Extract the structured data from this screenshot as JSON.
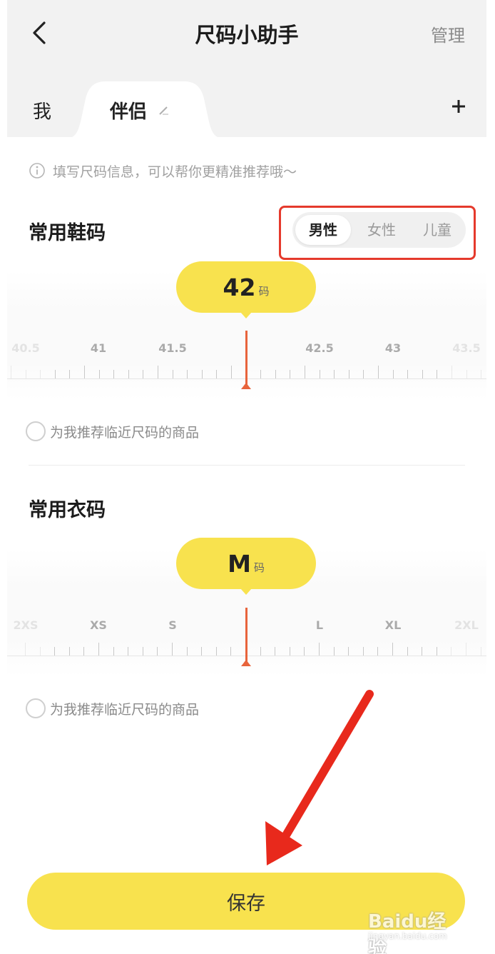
{
  "header": {
    "title": "尺码小助手",
    "manage_label": "管理"
  },
  "tabs": [
    {
      "label": "我"
    },
    {
      "label": "伴侣"
    }
  ],
  "icons": {
    "back": "chevron-left-icon",
    "edit": "pencil-icon",
    "add": "plus-icon",
    "info": "info-icon"
  },
  "tip": {
    "text": "填写尺码信息，可以帮你更精准推荐哦～"
  },
  "shoes": {
    "title": "常用鞋码",
    "gender_options": [
      "男性",
      "女性",
      "儿童"
    ],
    "selected_gender": "男性",
    "value": "42",
    "unit": "码",
    "ruler_labels": [
      "40.5",
      "41",
      "41.5",
      "42.5",
      "43",
      "43.5"
    ],
    "recommend_text": "为我推荐临近尺码的商品"
  },
  "clothes": {
    "title": "常用衣码",
    "value": "M",
    "unit": "码",
    "ruler_labels": [
      "2XS",
      "XS",
      "S",
      "L",
      "XL",
      "2XL"
    ],
    "recommend_text": "为我推荐临近尺码的商品"
  },
  "save_label": "保存",
  "watermark": {
    "brand": "Baidu经验",
    "url": "jingyan.baidu.com"
  },
  "colors": {
    "accent_yellow": "#f8e24e",
    "pointer": "#e8643c",
    "highlight_red": "#e53a2c"
  }
}
